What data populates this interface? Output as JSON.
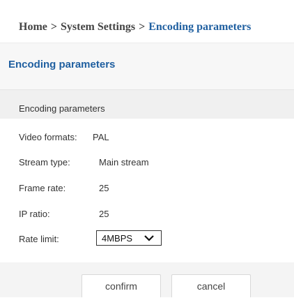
{
  "breadcrumb": {
    "home": "Home",
    "separator": ">",
    "system_settings": "System Settings",
    "current": "Encoding parameters"
  },
  "section": {
    "title": "Encoding parameters"
  },
  "panel": {
    "header": "Encoding parameters",
    "rows": [
      {
        "label": "Video formats:",
        "value": "PAL"
      },
      {
        "label": "Stream type:",
        "value": "Main stream"
      },
      {
        "label": "Frame rate:",
        "value": "25"
      },
      {
        "label": "IP ratio:",
        "value": "25"
      },
      {
        "label": "Rate limit:",
        "value": "4MBPS"
      }
    ]
  },
  "buttons": {
    "confirm": "confirm",
    "cancel": "cancel"
  },
  "colors": {
    "accent": "#1f5fa0",
    "header_bg": "#f0f0f0"
  },
  "icons": {
    "select_arrow": "chevron-down-icon"
  }
}
